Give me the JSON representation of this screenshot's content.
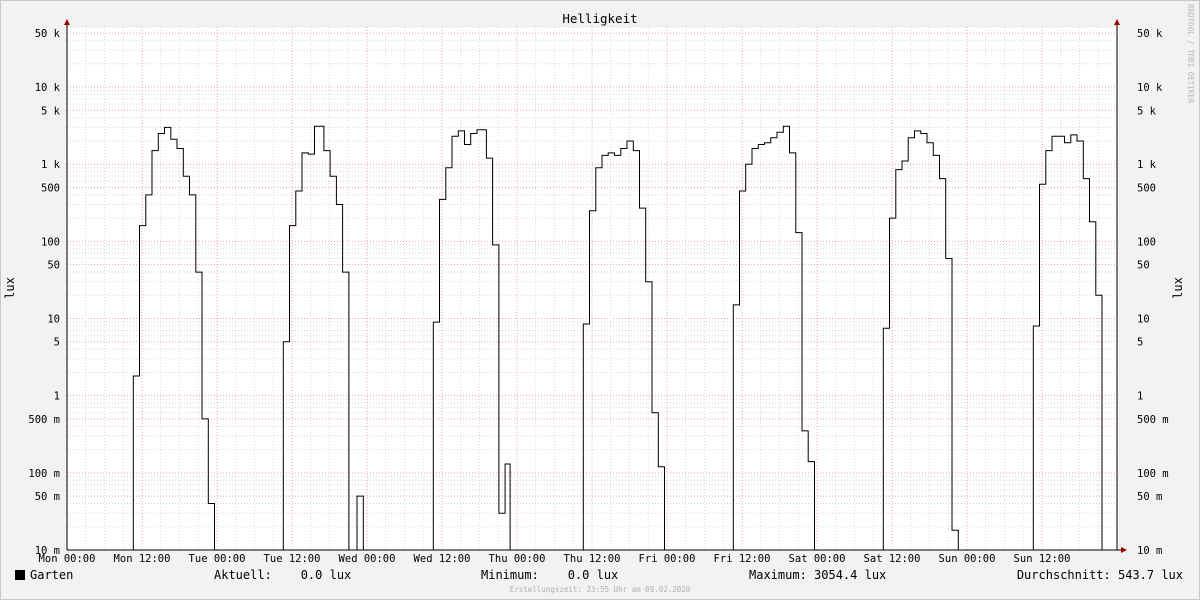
{
  "chart_data": {
    "type": "line",
    "title": "Helligkeit",
    "ylabel": "lux",
    "ylabel_right": "lux",
    "y_scale": "log",
    "ylim": [
      0.01,
      60000
    ],
    "y_ticks": [
      {
        "v": 0.01,
        "label": "10 m"
      },
      {
        "v": 0.05,
        "label": "50 m"
      },
      {
        "v": 0.1,
        "label": "100 m"
      },
      {
        "v": 0.5,
        "label": "500 m"
      },
      {
        "v": 1,
        "label": "1"
      },
      {
        "v": 5,
        "label": "5"
      },
      {
        "v": 10,
        "label": "10"
      },
      {
        "v": 50,
        "label": "50"
      },
      {
        "v": 100,
        "label": "100"
      },
      {
        "v": 500,
        "label": "500"
      },
      {
        "v": 1000,
        "label": "1 k"
      },
      {
        "v": 5000,
        "label": "5 k"
      },
      {
        "v": 10000,
        "label": "10 k"
      },
      {
        "v": 50000,
        "label": "50 k"
      }
    ],
    "x_ticks": [
      "Mon 00:00",
      "Mon 12:00",
      "Tue 00:00",
      "Tue 12:00",
      "Wed 00:00",
      "Wed 12:00",
      "Thu 00:00",
      "Thu 12:00",
      "Fri 00:00",
      "Fri 12:00",
      "Sat 00:00",
      "Sat 12:00",
      "Sun 00:00",
      "Sun 12:00"
    ],
    "x_unit": "hours since Mon 00:00",
    "xlim": [
      0,
      168
    ],
    "grid": true,
    "watermark": "RRDTOOL / TOBI OETIKER",
    "series": [
      {
        "name": "Garten",
        "color": "#000000",
        "points": [
          [
            0,
            0.01
          ],
          [
            10.6,
            0.01
          ],
          [
            10.6,
            1.8
          ],
          [
            11.6,
            1.8
          ],
          [
            11.6,
            160
          ],
          [
            12.6,
            160
          ],
          [
            12.6,
            400
          ],
          [
            13.6,
            400
          ],
          [
            13.6,
            1500
          ],
          [
            14.6,
            1500
          ],
          [
            14.6,
            2500
          ],
          [
            15.6,
            2500
          ],
          [
            15.6,
            3000
          ],
          [
            16.6,
            3000
          ],
          [
            16.6,
            2100
          ],
          [
            17.6,
            2100
          ],
          [
            17.6,
            1600
          ],
          [
            18.6,
            1600
          ],
          [
            18.6,
            700
          ],
          [
            19.6,
            700
          ],
          [
            19.6,
            400
          ],
          [
            20.6,
            400
          ],
          [
            20.6,
            40
          ],
          [
            21.6,
            40
          ],
          [
            21.6,
            0.5
          ],
          [
            22.6,
            0.5
          ],
          [
            22.6,
            0.04
          ],
          [
            23.6,
            0.04
          ],
          [
            23.6,
            0.01
          ],
          [
            34.6,
            0.01
          ],
          [
            34.6,
            5
          ],
          [
            35.6,
            5
          ],
          [
            35.6,
            160
          ],
          [
            36.6,
            160
          ],
          [
            36.6,
            450
          ],
          [
            37.6,
            450
          ],
          [
            37.6,
            1400
          ],
          [
            38.6,
            1400
          ],
          [
            38.6,
            1350
          ],
          [
            39.6,
            1350
          ],
          [
            39.6,
            3100
          ],
          [
            41.1,
            3100
          ],
          [
            41.1,
            1500
          ],
          [
            42.1,
            1500
          ],
          [
            42.1,
            700
          ],
          [
            43.1,
            700
          ],
          [
            43.1,
            300
          ],
          [
            44.1,
            300
          ],
          [
            44.1,
            40
          ],
          [
            45.1,
            40
          ],
          [
            45.1,
            0.01
          ],
          [
            46.4,
            0.01
          ],
          [
            46.4,
            0.05
          ],
          [
            47.4,
            0.05
          ],
          [
            47.4,
            0.01
          ],
          [
            58.6,
            0.01
          ],
          [
            58.6,
            9
          ],
          [
            59.6,
            9
          ],
          [
            59.6,
            350
          ],
          [
            60.6,
            350
          ],
          [
            60.6,
            900
          ],
          [
            61.6,
            900
          ],
          [
            61.6,
            2300
          ],
          [
            62.6,
            2300
          ],
          [
            62.6,
            2700
          ],
          [
            63.6,
            2700
          ],
          [
            63.6,
            1800
          ],
          [
            64.6,
            1800
          ],
          [
            64.6,
            2500
          ],
          [
            65.6,
            2500
          ],
          [
            65.6,
            2800
          ],
          [
            67.1,
            2800
          ],
          [
            67.1,
            1200
          ],
          [
            68.1,
            1200
          ],
          [
            68.1,
            90
          ],
          [
            69.1,
            90
          ],
          [
            69.1,
            0.03
          ],
          [
            70.1,
            0.03
          ],
          [
            70.1,
            0.13
          ],
          [
            70.9,
            0.13
          ],
          [
            70.9,
            0.01
          ],
          [
            82.6,
            0.01
          ],
          [
            82.6,
            8.5
          ],
          [
            83.6,
            8.5
          ],
          [
            83.6,
            250
          ],
          [
            84.6,
            250
          ],
          [
            84.6,
            900
          ],
          [
            85.6,
            900
          ],
          [
            85.6,
            1300
          ],
          [
            86.6,
            1300
          ],
          [
            86.6,
            1400
          ],
          [
            87.6,
            1400
          ],
          [
            87.6,
            1300
          ],
          [
            88.6,
            1300
          ],
          [
            88.6,
            1600
          ],
          [
            89.6,
            1600
          ],
          [
            89.6,
            2000
          ],
          [
            90.6,
            2000
          ],
          [
            90.6,
            1500
          ],
          [
            91.6,
            1500
          ],
          [
            91.6,
            270
          ],
          [
            92.6,
            270
          ],
          [
            92.6,
            30
          ],
          [
            93.6,
            30
          ],
          [
            93.6,
            0.6
          ],
          [
            94.6,
            0.6
          ],
          [
            94.6,
            0.12
          ],
          [
            95.6,
            0.12
          ],
          [
            95.6,
            0.01
          ],
          [
            106.6,
            0.01
          ],
          [
            106.6,
            15
          ],
          [
            107.6,
            15
          ],
          [
            107.6,
            450
          ],
          [
            108.6,
            450
          ],
          [
            108.6,
            1000
          ],
          [
            109.6,
            1000
          ],
          [
            109.6,
            1600
          ],
          [
            110.6,
            1600
          ],
          [
            110.6,
            1800
          ],
          [
            111.6,
            1800
          ],
          [
            111.6,
            1900
          ],
          [
            112.6,
            1900
          ],
          [
            112.6,
            2200
          ],
          [
            113.6,
            2200
          ],
          [
            113.6,
            2600
          ],
          [
            114.6,
            2600
          ],
          [
            114.6,
            3100
          ],
          [
            115.6,
            3100
          ],
          [
            115.6,
            1400
          ],
          [
            116.6,
            1400
          ],
          [
            116.6,
            130
          ],
          [
            117.6,
            130
          ],
          [
            117.6,
            0.35
          ],
          [
            118.6,
            0.35
          ],
          [
            118.6,
            0.14
          ],
          [
            119.6,
            0.14
          ],
          [
            119.6,
            0.01
          ],
          [
            130.6,
            0.01
          ],
          [
            130.6,
            7.5
          ],
          [
            131.6,
            7.5
          ],
          [
            131.6,
            200
          ],
          [
            132.6,
            200
          ],
          [
            132.6,
            850
          ],
          [
            133.6,
            850
          ],
          [
            133.6,
            1100
          ],
          [
            134.6,
            1100
          ],
          [
            134.6,
            2200
          ],
          [
            135.6,
            2200
          ],
          [
            135.6,
            2700
          ],
          [
            136.6,
            2700
          ],
          [
            136.6,
            2500
          ],
          [
            137.6,
            2500
          ],
          [
            137.6,
            1900
          ],
          [
            138.6,
            1900
          ],
          [
            138.6,
            1300
          ],
          [
            139.6,
            1300
          ],
          [
            139.6,
            650
          ],
          [
            140.6,
            650
          ],
          [
            140.6,
            60
          ],
          [
            141.6,
            60
          ],
          [
            141.6,
            0.018
          ],
          [
            142.6,
            0.018
          ],
          [
            142.6,
            0.01
          ],
          [
            154.6,
            0.01
          ],
          [
            154.6,
            8
          ],
          [
            155.6,
            8
          ],
          [
            155.6,
            550
          ],
          [
            156.6,
            550
          ],
          [
            156.6,
            1500
          ],
          [
            157.6,
            1500
          ],
          [
            157.6,
            2300
          ],
          [
            159.6,
            2300
          ],
          [
            159.6,
            1900
          ],
          [
            160.6,
            1900
          ],
          [
            160.6,
            2400
          ],
          [
            161.6,
            2400
          ],
          [
            161.6,
            2000
          ],
          [
            162.6,
            2000
          ],
          [
            162.6,
            650
          ],
          [
            163.6,
            650
          ],
          [
            163.6,
            180
          ],
          [
            164.6,
            180
          ],
          [
            164.6,
            20
          ],
          [
            165.6,
            20
          ],
          [
            165.6,
            0.01
          ],
          [
            168,
            0.01
          ]
        ]
      }
    ]
  },
  "legend": {
    "series_name": "Garten",
    "current": "Aktuell:    0.0 lux",
    "minimum": "Minimum:    0.0 lux",
    "maximum": "Maximum: 3054.4 lux",
    "average": "Durchschnitt: 543.7 lux"
  },
  "footer": "Erstellungszeit: 23:55 Uhr am 09.02.2020",
  "colors": {
    "background": "#f2f2f2",
    "canvas": "#ffffff",
    "major_grid": "#f0a0a0",
    "minor_grid": "#d8d8d8",
    "axis": "#000000",
    "arrow": "#a00000"
  }
}
